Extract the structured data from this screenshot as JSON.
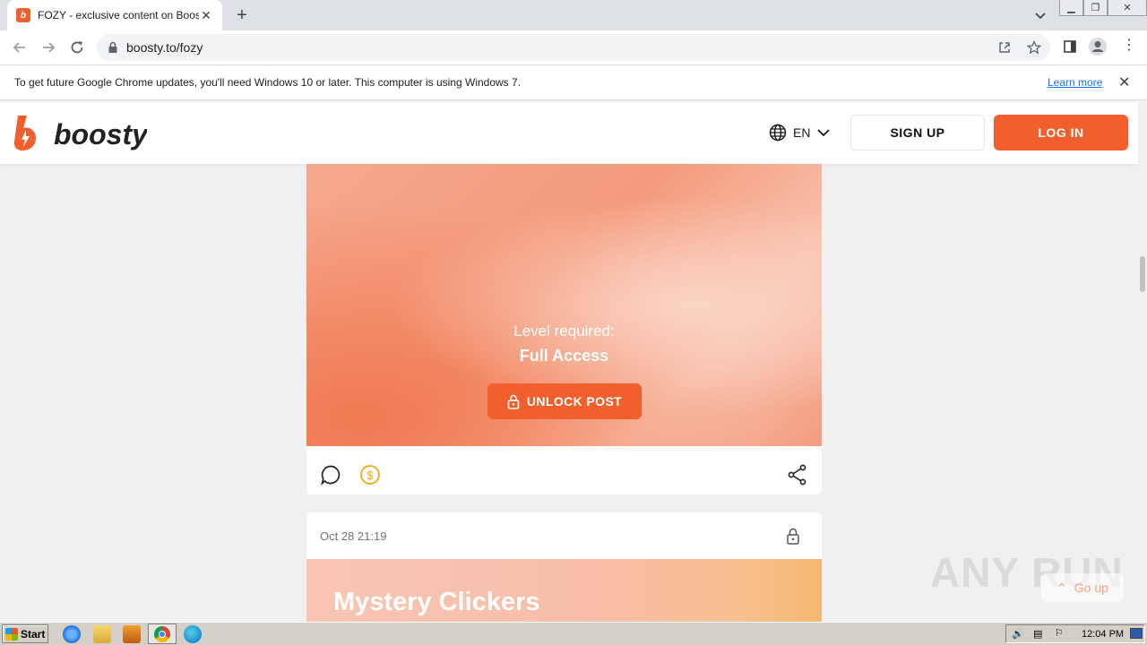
{
  "browser": {
    "tab_title": "FOZY - exclusive content on Boosty",
    "tab_favicon": "b",
    "url": "boosty.to/fozy",
    "infobar_text": "To get future Google Chrome updates, you'll need Windows 10 or later. This computer is using Windows 7.",
    "infobar_link": "Learn more"
  },
  "site": {
    "brand": "boosty",
    "lang": "EN",
    "signup_label": "SIGN UP",
    "login_label": "LOG IN",
    "accent_color": "#f15f2c"
  },
  "post1": {
    "level_label": "Level required:",
    "level_name": "Full Access",
    "unlock_label": "UNLOCK POST"
  },
  "post2": {
    "date": "Oct 28 21:19",
    "title": "Mystery Clickers"
  },
  "page": {
    "goup_label": "Go up",
    "watermark": "ANY RUN"
  },
  "taskbar": {
    "start_label": "Start",
    "clock": "12:04 PM"
  }
}
